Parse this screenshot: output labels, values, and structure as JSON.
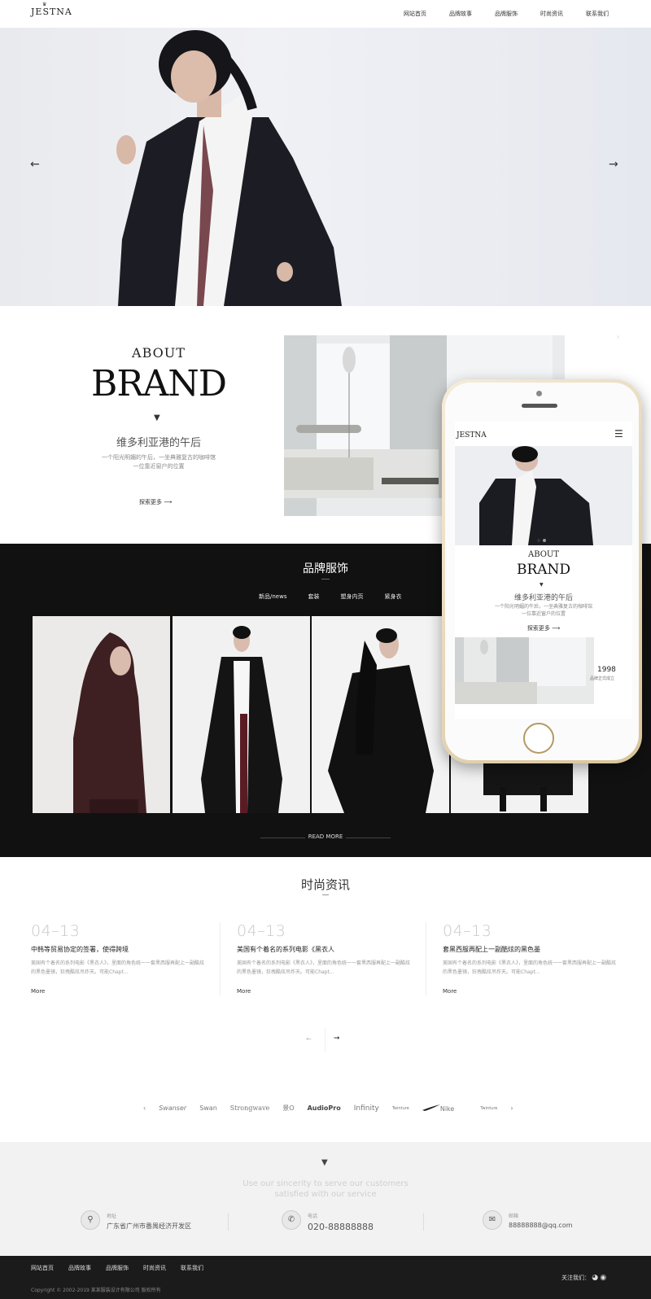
{
  "header": {
    "logo": "JESTNA",
    "nav": [
      "网站首页",
      "品牌故事",
      "品牌服饰",
      "时尚资讯",
      "联系我们"
    ]
  },
  "hero": {
    "prev": "←",
    "next": "→"
  },
  "about": {
    "small": "ABOUT",
    "big": "BRAND",
    "subtitle": "维多利亚港的午后",
    "desc_line1": "一个阳光明媚的午后，一坐典雅复古的咖啡馆",
    "desc_line2": "一位靠近窗户的位置",
    "more": "探索更多"
  },
  "brand": {
    "title": "品牌服饰",
    "tabs": [
      "新品/news",
      "套装",
      "塑身内页",
      "紧身衣"
    ],
    "read_more": "READ MORE"
  },
  "phone_screen": {
    "logo": "JESTNA",
    "about_small": "ABOUT",
    "about_big": "BRAND",
    "subtitle": "维多利亚港的午后",
    "desc_line1": "一个阳光明媚的午后，一坐典雅复古的咖啡馆",
    "desc_line2": "一位靠近窗户的位置",
    "more": "探索更多",
    "year": "1998",
    "year_caption": "品牌正式成立"
  },
  "news": {
    "title": "时尚资讯",
    "items": [
      {
        "date": "04–13",
        "title": "中韩等贸易协定的签署，使得跨境",
        "desc1": "美国有个着名的系列电影《黑衣人》，里面的角色统一一套黑西服再配上一副酷炫",
        "desc2": "的黑色墨镜，狂拽酷炫吊炸天。可能Chapt...",
        "more": "More"
      },
      {
        "date": "04–13",
        "title": "美国有个着名的系列电影《黑衣人",
        "desc1": "美国有个着名的系列电影《黑衣人》，里面的角色统一一套黑西服再配上一副酷炫",
        "desc2": "的黑色墨镜，狂拽酷炫吊炸天。可能Chapt...",
        "more": "More"
      },
      {
        "date": "04–13",
        "title": "套黑西服再配上一副酷炫的黑色墨",
        "desc1": "美国有个着名的系列电影《黑衣人》，里面的角色统一一套黑西服再配上一副酷炫",
        "desc2": "的黑色墨镜，狂拽酷炫吊炸天。可能Chapt...",
        "more": "More"
      }
    ],
    "pager_prev": "←",
    "pager_next": "➞"
  },
  "partners": {
    "prev": "‹",
    "next": "›",
    "logos": [
      "Swanser",
      "Swan",
      "Strongwave",
      "景O",
      "AudioPro",
      "Infinity",
      "Twinture",
      "Nike",
      "Twinture"
    ]
  },
  "contact": {
    "slogan_line1": "Use our sincerity to serve our customers",
    "slogan_line2": "satisfied with our service",
    "address_label": "地址",
    "address": "广东省广州市番禺经济开发区",
    "phone_label": "电话",
    "phone": "020-88888888",
    "email_label": "邮箱",
    "email": "88888888@qq.com"
  },
  "footer": {
    "nav": [
      "网站首页",
      "品牌故事",
      "品牌服饰",
      "时尚资讯",
      "联系我们"
    ],
    "copyright": "Copyright © 2002-2019 某某服装设计有限公司 版权所有",
    "follow": "关注我们："
  }
}
